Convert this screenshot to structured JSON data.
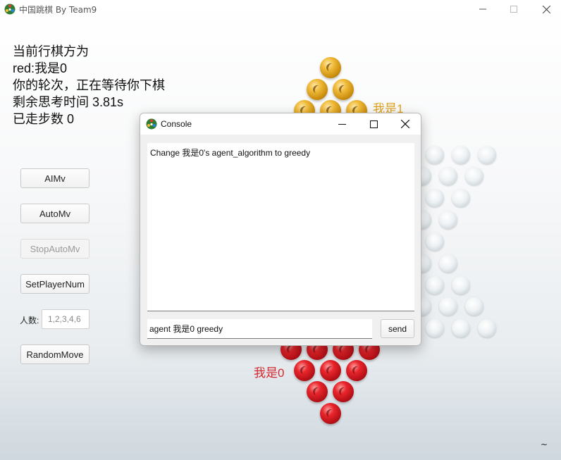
{
  "window": {
    "title": "中国跳棋 By Team9",
    "minimize_icon": "minimize-icon",
    "maximize_icon": "maximize-icon",
    "close_icon": "close-icon"
  },
  "status": {
    "line1": "当前行棋方为",
    "line2": "red:我是0",
    "line3": "你的轮次，正在等待你下棋",
    "line4": "剩余思考时间  3.81s",
    "line5": "已走步数  0"
  },
  "controls": {
    "ai_move": "AIMv",
    "auto_move": "AutoMv",
    "stop_auto_move": "StopAutoMv",
    "set_player_num": "SetPlayerNum",
    "player_count_label": "人数:",
    "player_count_placeholder": "1,2,3,4,6",
    "random_move": "RandomMove"
  },
  "board": {
    "player_top_label": "我是1",
    "player_top_color": "#e0a21a",
    "player_bottom_label": "我是0",
    "player_bottom_color": "#d42a30"
  },
  "console": {
    "title": "Console",
    "output": "Change 我是0's agent_algorithm to greedy",
    "input_value": "agent 我是0 greedy",
    "send_label": "send"
  },
  "corner_mark": "~"
}
